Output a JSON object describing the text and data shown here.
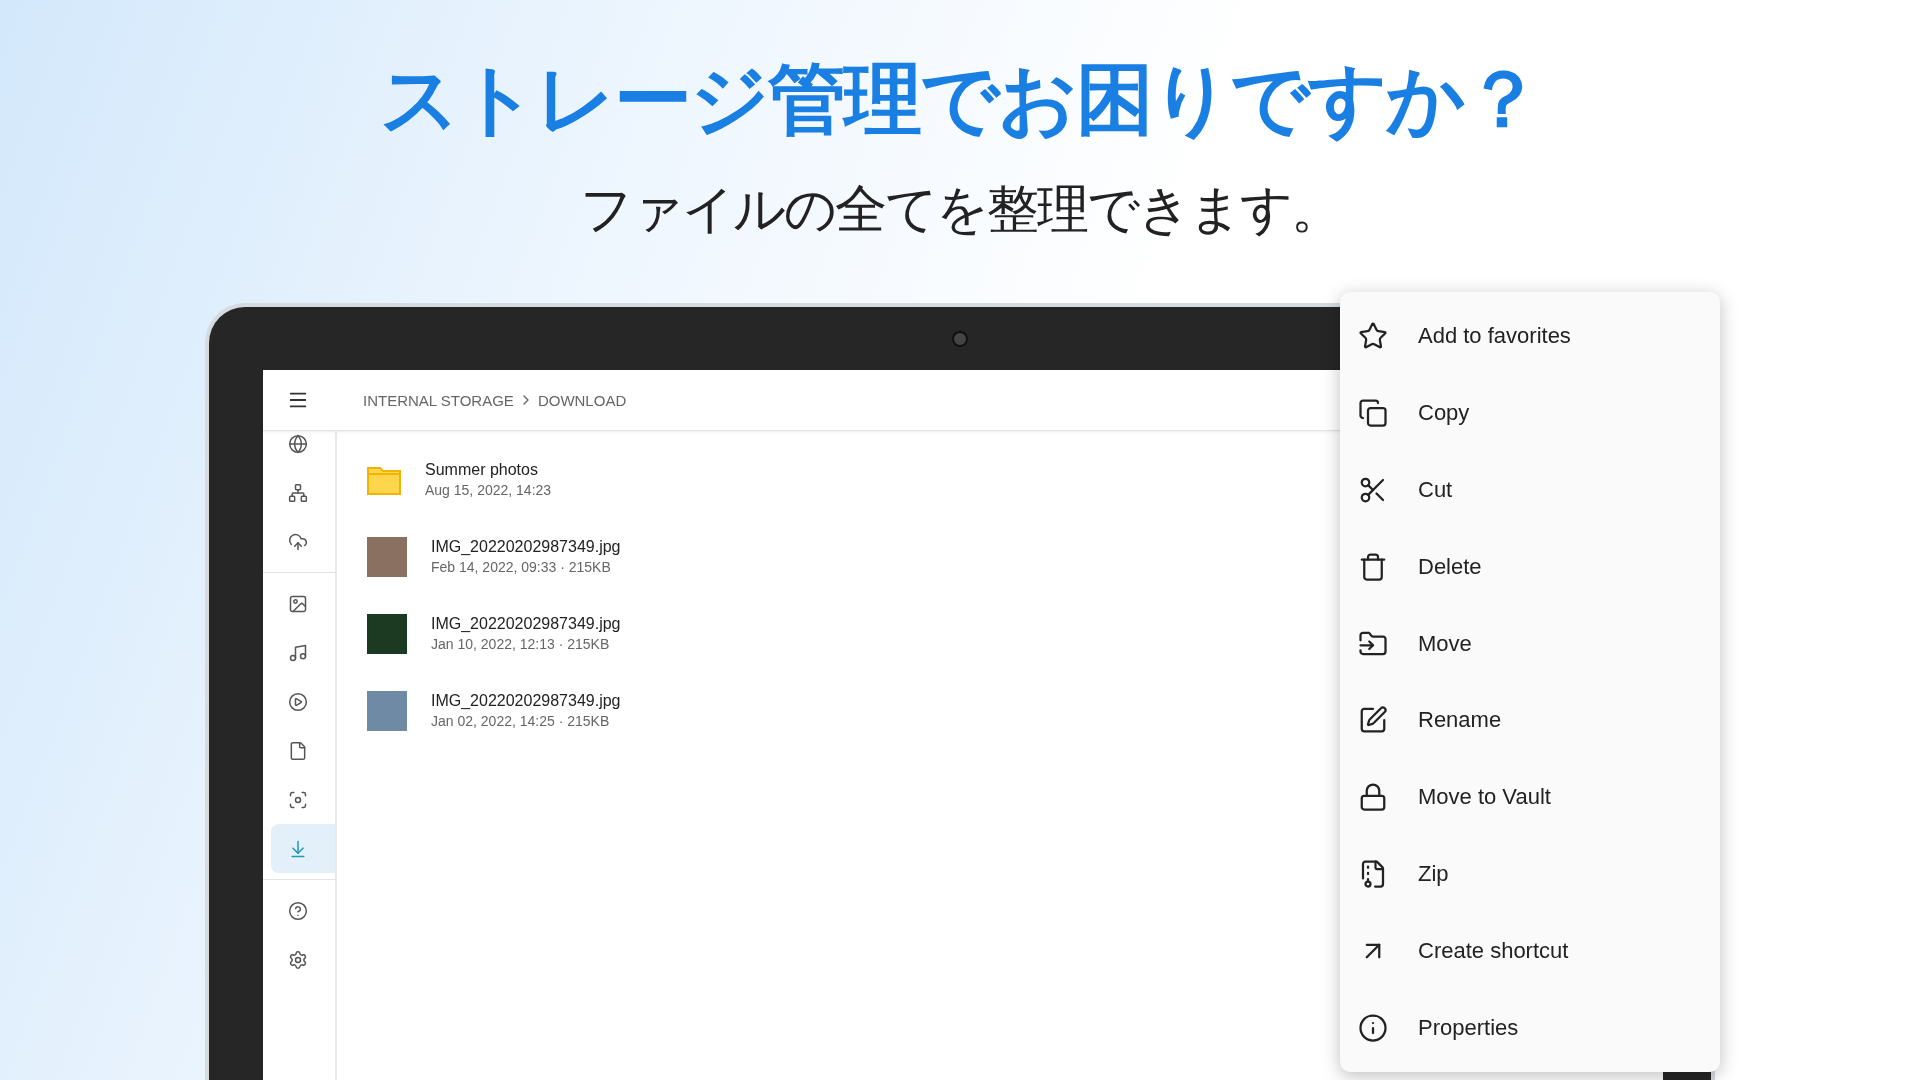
{
  "headline": "ストレージ管理でお困りですか？",
  "subtitle": "ファイルの全てを整理できます。",
  "app": {
    "breadcrumb": [
      "INTERNAL STORAGE",
      "DOWNLOAD"
    ],
    "sidebar": {
      "groups": [
        [
          {
            "selected": false
          },
          {
            "selected": false
          },
          {
            "selected": false
          }
        ],
        [
          {
            "selected": false
          },
          {
            "selected": false
          },
          {
            "selected": false
          },
          {
            "selected": false
          },
          {
            "selected": false
          },
          {
            "selected": true
          }
        ],
        [
          {
            "selected": false
          },
          {
            "selected": false
          }
        ]
      ]
    },
    "files": [
      {
        "kind": "folder",
        "name": "Summer photos",
        "meta": "Aug 15, 2022, 14:23"
      },
      {
        "kind": "image",
        "name": "IMG_20220202987349.jpg",
        "meta": "Feb 14, 2022, 09:33 · 215KB"
      },
      {
        "kind": "image",
        "name": "IMG_20220202987349.jpg",
        "meta": "Jan 10, 2022, 12:13 · 215KB"
      },
      {
        "kind": "image",
        "name": "IMG_20220202987349.jpg",
        "meta": "Jan 02, 2022, 14:25 · 215KB"
      }
    ]
  },
  "context_menu": [
    "Add to favorites",
    "Copy",
    "Cut",
    "Delete",
    "Move",
    "Rename",
    "Move to Vault",
    "Zip",
    "Create shortcut",
    "Properties"
  ]
}
